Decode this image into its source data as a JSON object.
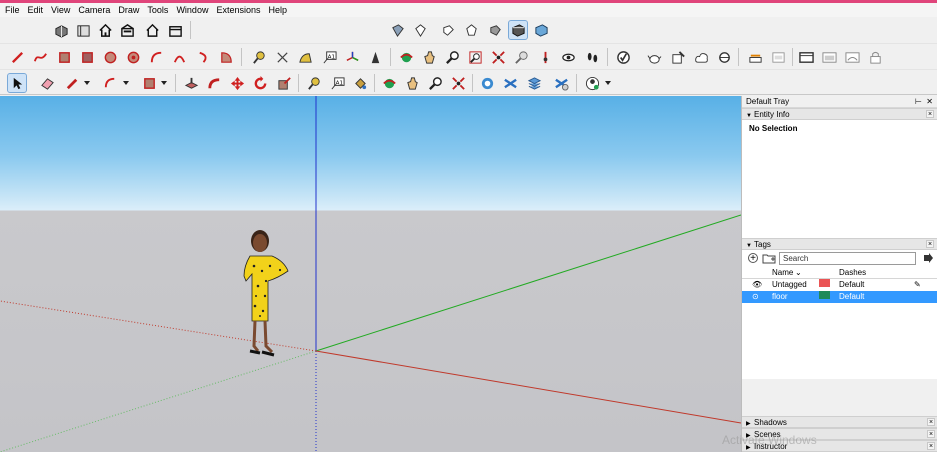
{
  "menu": [
    "File",
    "Edit",
    "View",
    "Camera",
    "Draw",
    "Tools",
    "Window",
    "Extensions",
    "Help"
  ],
  "toolbar": {
    "row1_icons": [
      "3d-warehouse-icon",
      "extension-warehouse-icon",
      "home-icon",
      "warehouse-upload-icon",
      "house-outline-icon",
      "shop-icon",
      "iso-view-icon",
      "top-view-icon",
      "front-view-icon",
      "right-view-icon",
      "back-view-icon",
      "left-view-icon",
      "shaded-style-icon",
      "monochrome-style-icon"
    ],
    "row2_icons": [
      "line-icon",
      "freehand-icon",
      "rectangle-icon",
      "rotated-rectangle-icon",
      "circle-icon",
      "polygon-icon",
      "arc-icon",
      "two-point-arc-icon",
      "three-point-arc-icon",
      "pie-icon",
      "tape-measure-icon",
      "dimension-icon",
      "protractor-icon",
      "text-icon",
      "axes-icon",
      "3d-text-icon",
      "orbit-icon",
      "pan-icon",
      "zoom-icon",
      "zoom-window-icon",
      "zoom-extents-icon",
      "previous-view-icon",
      "position-camera-icon",
      "look-around-icon",
      "walk-icon",
      "model-info-icon",
      "teapot-icon",
      "solid-tools-icon",
      "cloud-icon",
      "sandbox-icon",
      "section-plane-icon",
      "display-section-icon",
      "window-icon",
      "layout-icon",
      "scene-icon",
      "lock-icon"
    ],
    "row3_icons": [
      "select-icon",
      "eraser-icon",
      "pencil-icon",
      "arc-dropdown-icon",
      "rectangle-dropdown-icon",
      "push-pull-icon",
      "follow-me-icon",
      "move-icon",
      "rotate-icon",
      "scale-icon",
      "tape-measure-icon",
      "text-icon",
      "paint-bucket-icon",
      "orbit-icon",
      "pan-icon",
      "zoom-icon",
      "zoom-extents-icon",
      "warehouse-icon",
      "components-icon",
      "materials-icon",
      "styles-icon",
      "account-icon"
    ]
  },
  "tray": {
    "title": "Default Tray",
    "entity_info": {
      "label": "Entity Info",
      "selection": "No Selection"
    },
    "tags": {
      "label": "Tags",
      "search_placeholder": "Search",
      "columns": {
        "name": "Name",
        "dashes": "Dashes"
      },
      "rows": [
        {
          "name": "Untagged",
          "color": "#ea5455",
          "dashes": "Default",
          "selected": false
        },
        {
          "name": "floor",
          "color": "#1e8a5a",
          "dashes": "Default",
          "selected": true
        }
      ]
    },
    "collapsed_panels": [
      "Shadows",
      "Scenes",
      "Instructor"
    ]
  },
  "watermark": "Activate Windows",
  "colors": {
    "accent": "#3399ff",
    "sky": "#8ac9ef",
    "ground": "#c4c4c8",
    "axis_red": "#c0392b",
    "axis_green": "#22aa22",
    "axis_blue": "#2233cc"
  }
}
